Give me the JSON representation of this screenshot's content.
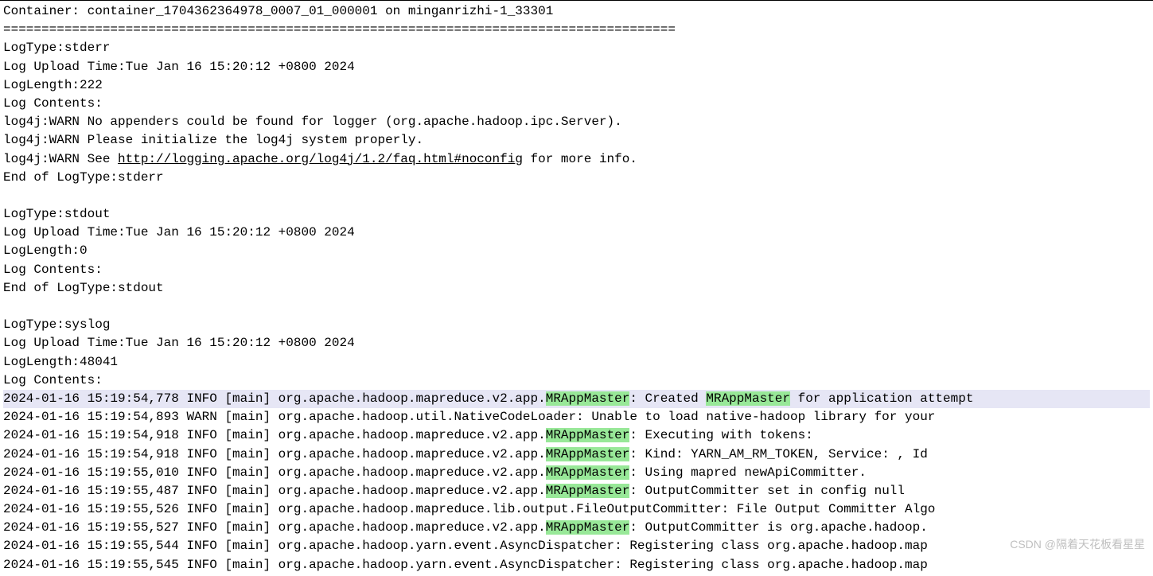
{
  "header": {
    "container_line": "Container: container_1704362364978_0007_01_000001 on minganrizhi-1_33301",
    "separator": "========================================================================================"
  },
  "stderr": {
    "logtype": "LogType:stderr",
    "upload_time": "Log Upload Time:Tue Jan 16 15:20:12 +0800 2024",
    "length": "LogLength:222",
    "contents_label": "Log Contents:",
    "line1": "log4j:WARN No appenders could be found for logger (org.apache.hadoop.ipc.Server).",
    "line2": "log4j:WARN Please initialize the log4j system properly.",
    "line3_prefix": "log4j:WARN See ",
    "line3_link": "http://logging.apache.org/log4j/1.2/faq.html#noconfig",
    "line3_suffix": " for more info.",
    "end": "End of LogType:stderr"
  },
  "stdout": {
    "logtype": "LogType:stdout",
    "upload_time": "Log Upload Time:Tue Jan 16 15:20:12 +0800 2024",
    "length": "LogLength:0",
    "contents_label": "Log Contents:",
    "end": "End of LogType:stdout"
  },
  "syslog": {
    "logtype": "LogType:syslog",
    "upload_time": "Log Upload Time:Tue Jan 16 15:20:12 +0800 2024",
    "length": "LogLength:48041",
    "contents_label": "Log Contents:",
    "lines": [
      {
        "prefix": "2024-01-16 15:19:54,778 INFO [main] org.apache.hadoop.mapreduce.v2.app.",
        "hl1": "MRAppMaster",
        "mid": ": Created ",
        "hl2": "MRAppMaster",
        "suffix": " for application attempt",
        "selected": true
      },
      {
        "prefix": "2024-01-16 15:19:54,893 WARN [main] org.apache.hadoop.util.NativeCodeLoader: Unable to load native-hadoop library for your",
        "hl1": "",
        "mid": "",
        "hl2": "",
        "suffix": "",
        "selected": false
      },
      {
        "prefix": "2024-01-16 15:19:54,918 INFO [main] org.apache.hadoop.mapreduce.v2.app.",
        "hl1": "MRAppMaster",
        "mid": ": Executing with tokens:",
        "hl2": "",
        "suffix": "",
        "selected": false
      },
      {
        "prefix": "2024-01-16 15:19:54,918 INFO [main] org.apache.hadoop.mapreduce.v2.app.",
        "hl1": "MRAppMaster",
        "mid": ": Kind: YARN_AM_RM_TOKEN, Service: , Id",
        "hl2": "",
        "suffix": "",
        "selected": false
      },
      {
        "prefix": "2024-01-16 15:19:55,010 INFO [main] org.apache.hadoop.mapreduce.v2.app.",
        "hl1": "MRAppMaster",
        "mid": ": Using mapred newApiCommitter.",
        "hl2": "",
        "suffix": "",
        "selected": false
      },
      {
        "prefix": "2024-01-16 15:19:55,487 INFO [main] org.apache.hadoop.mapreduce.v2.app.",
        "hl1": "MRAppMaster",
        "mid": ": OutputCommitter set in config null",
        "hl2": "",
        "suffix": "",
        "selected": false
      },
      {
        "prefix": "2024-01-16 15:19:55,526 INFO [main] org.apache.hadoop.mapreduce.lib.output.FileOutputCommitter: File Output Committer Algo",
        "hl1": "",
        "mid": "",
        "hl2": "",
        "suffix": "",
        "selected": false
      },
      {
        "prefix": "2024-01-16 15:19:55,527 INFO [main] org.apache.hadoop.mapreduce.v2.app.",
        "hl1": "MRAppMaster",
        "mid": ": OutputCommitter is org.apache.hadoop.",
        "hl2": "",
        "suffix": "",
        "selected": false
      },
      {
        "prefix": "2024-01-16 15:19:55,544 INFO [main] org.apache.hadoop.yarn.event.AsyncDispatcher: Registering class org.apache.hadoop.map",
        "hl1": "",
        "mid": "",
        "hl2": "",
        "suffix": "",
        "selected": false
      },
      {
        "prefix": "2024-01-16 15:19:55,545 INFO [main] org.apache.hadoop.yarn.event.AsyncDispatcher: Registering class org.apache.hadoop.map",
        "hl1": "",
        "mid": "",
        "hl2": "",
        "suffix": "",
        "selected": false
      }
    ]
  },
  "watermark": "CSDN @隔着天花板看星星"
}
